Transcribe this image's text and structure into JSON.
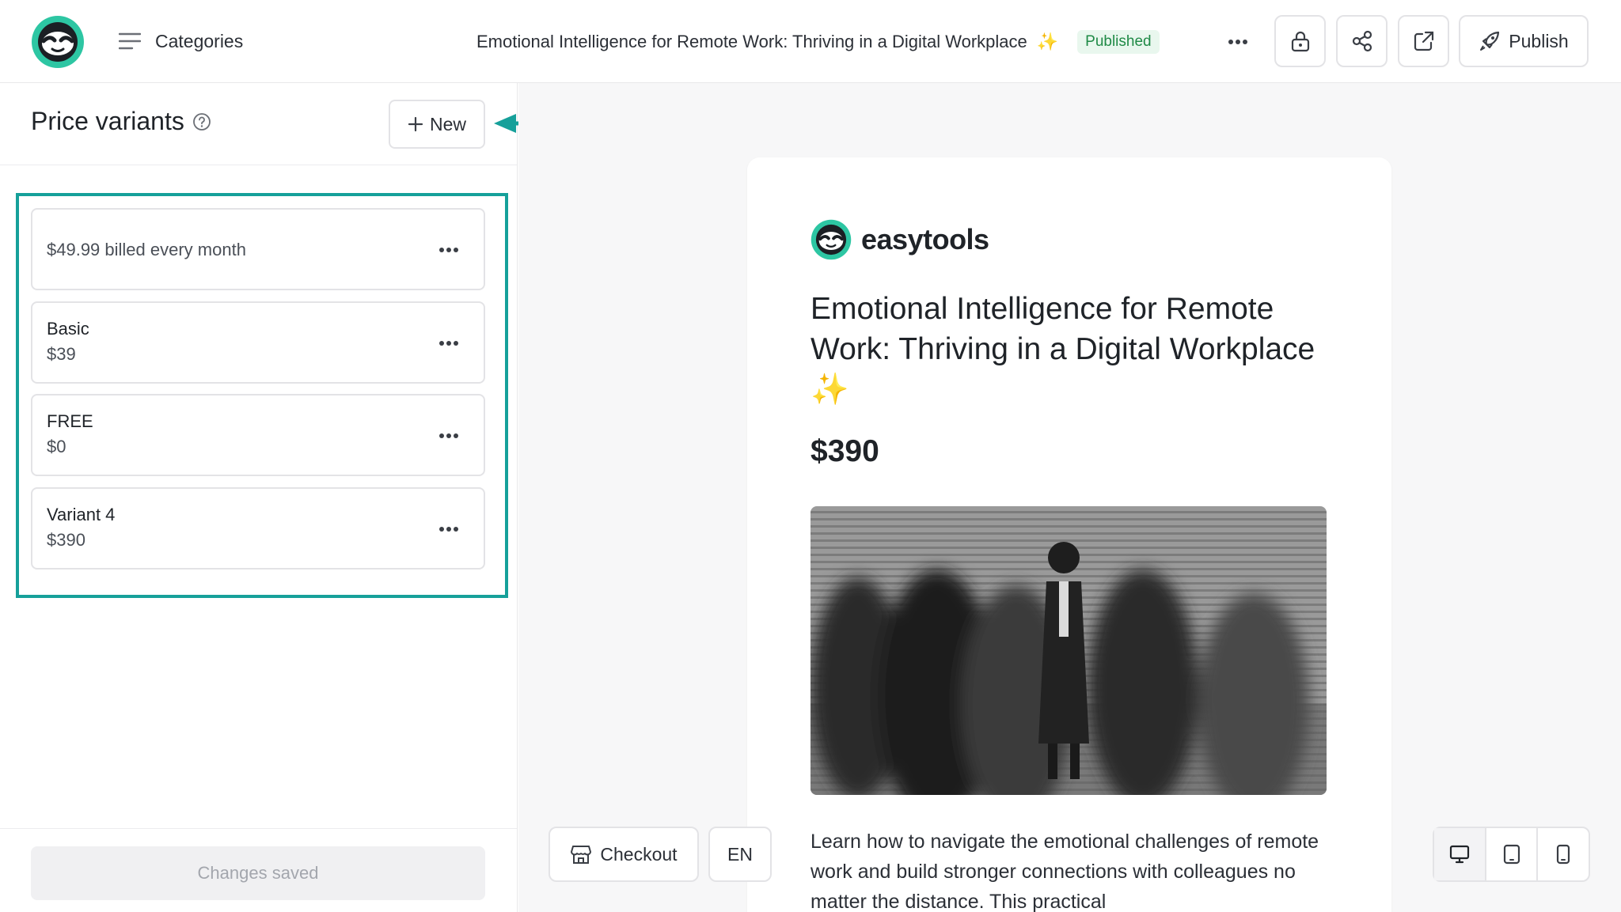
{
  "topbar": {
    "categories_label": "Categories",
    "title": "Emotional Intelligence for Remote Work: Thriving in a Digital Workplace",
    "title_emoji": "✨",
    "status_badge": "Published",
    "publish_label": "Publish",
    "icons": [
      "menu-icon",
      "more-icon",
      "lock-icon",
      "share-icon",
      "external-link-icon",
      "rocket-icon"
    ]
  },
  "left_panel": {
    "title": "Price variants",
    "new_label": "New",
    "variants": [
      {
        "name": "",
        "price": "$49.99 billed every month"
      },
      {
        "name": "Basic",
        "price": "$39"
      },
      {
        "name": "FREE",
        "price": "$0"
      },
      {
        "name": "Variant 4",
        "price": "$390"
      }
    ],
    "footer_status": "Changes saved"
  },
  "preview": {
    "brand_name": "easytools",
    "title": "Emotional Intelligence for Remote Work: Thriving in a Digital Workplace",
    "title_emoji": "✨",
    "price": "$390",
    "description": "Learn how to navigate the emotional challenges of remote work and build stronger connections with colleagues no matter the distance. This practical",
    "checkout_label": "Checkout",
    "language": "EN",
    "device_views": [
      "desktop",
      "tablet",
      "mobile"
    ],
    "active_device": "desktop"
  },
  "colors": {
    "accent": "#16a09a",
    "published_text": "#1f8a46",
    "published_bg": "#e9f7ee"
  }
}
